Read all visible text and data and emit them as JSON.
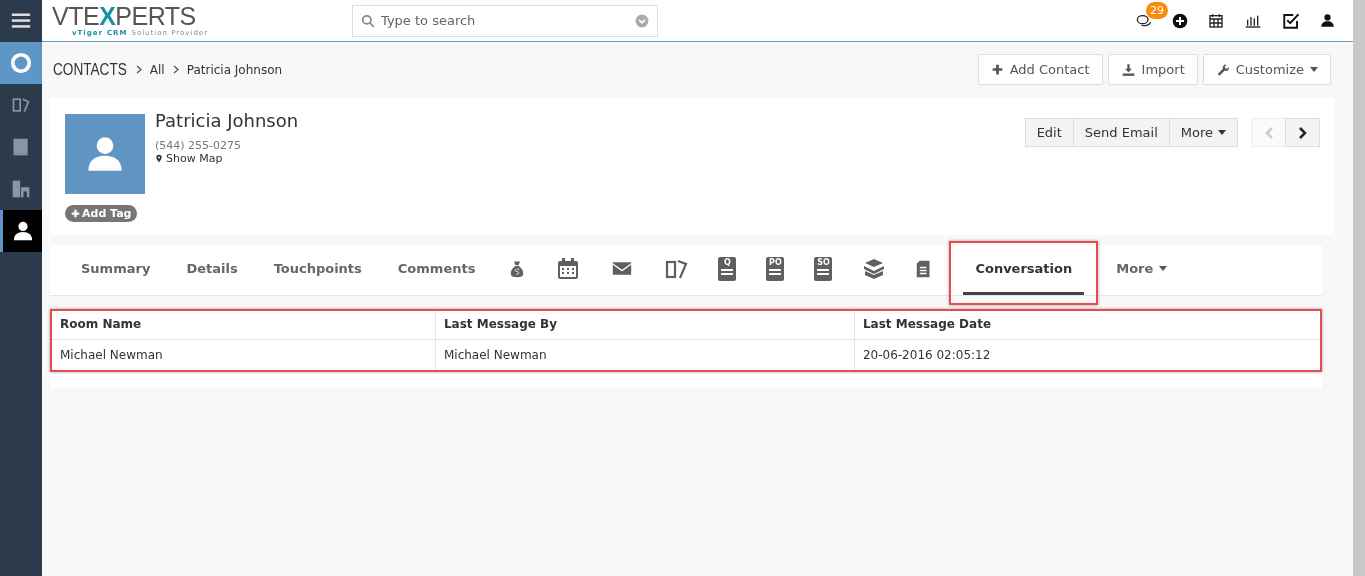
{
  "sidebar": {
    "items": [
      {
        "kind": "lifebuoy",
        "selected": false,
        "highlighted": true
      },
      {
        "kind": "tickets",
        "selected": false,
        "highlighted": false
      },
      {
        "kind": "help",
        "selected": false,
        "highlighted": false
      },
      {
        "kind": "building",
        "selected": false,
        "highlighted": false
      },
      {
        "kind": "person",
        "selected": true,
        "highlighted": false
      }
    ]
  },
  "header": {
    "logo": {
      "title_left": "VTE",
      "title_x": "X",
      "title_right": "PERTS",
      "tagline_a": "vTiger",
      "tagline_b": "CRM",
      "tagline_c": "Solution Provider"
    },
    "search": {
      "placeholder": "Type to search"
    },
    "badge": "29",
    "icons": [
      {
        "kind": "chat"
      },
      {
        "kind": "plus"
      },
      {
        "kind": "calendar"
      },
      {
        "kind": "chart"
      },
      {
        "kind": "check"
      },
      {
        "kind": "user"
      }
    ]
  },
  "breadcrumb": [
    "CONTACTS",
    "All",
    "Patricia Johnson"
  ],
  "actions": [
    {
      "kind": "plus",
      "label": "Add Contact",
      "caret": false
    },
    {
      "kind": "download",
      "label": "Import",
      "caret": false
    },
    {
      "kind": "wrench",
      "label": "Customize",
      "caret": true
    }
  ],
  "record": {
    "name": "Patricia Johnson",
    "phone": "(544) 255-0275",
    "map_link": "Show Map",
    "tag_button": "Add Tag",
    "buttons": [
      {
        "label": "Edit",
        "caret": false
      },
      {
        "label": "Send Email",
        "caret": false
      },
      {
        "label": "More",
        "caret": true
      }
    ],
    "prev_disabled": true,
    "next_disabled": false
  },
  "tabs": [
    {
      "kind": "text",
      "label": "Summary",
      "selected": false,
      "highlighted": false
    },
    {
      "kind": "text",
      "label": "Details",
      "selected": false,
      "highlighted": false
    },
    {
      "kind": "text",
      "label": "Touchpoints",
      "selected": false,
      "highlighted": false
    },
    {
      "kind": "text",
      "label": "Comments",
      "selected": false,
      "highlighted": false
    },
    {
      "kind": "moneybag",
      "selected": false,
      "highlighted": false
    },
    {
      "kind": "calendar",
      "selected": false,
      "highlighted": false
    },
    {
      "kind": "mail",
      "selected": false,
      "highlighted": false
    },
    {
      "kind": "tickets",
      "selected": false,
      "highlighted": false
    },
    {
      "kind": "doc",
      "glyph": "Q",
      "selected": false,
      "highlighted": false
    },
    {
      "kind": "doc",
      "glyph": "PO",
      "selected": false,
      "highlighted": false
    },
    {
      "kind": "doc",
      "glyph": "SO",
      "selected": false,
      "highlighted": false
    },
    {
      "kind": "box",
      "selected": false,
      "highlighted": false
    },
    {
      "kind": "file",
      "selected": false,
      "highlighted": false
    },
    {
      "kind": "text",
      "label": "Conversation",
      "selected": true,
      "highlighted": true
    },
    {
      "kind": "menu",
      "label": "More",
      "selected": false,
      "highlighted": false
    }
  ],
  "table": {
    "highlighted": true,
    "columns": [
      "Room Name",
      "Last Message By",
      "Last Message Date"
    ],
    "rows": [
      [
        "Michael Newman",
        "Michael Newman",
        "20-06-2016 02:05:12"
      ]
    ]
  }
}
